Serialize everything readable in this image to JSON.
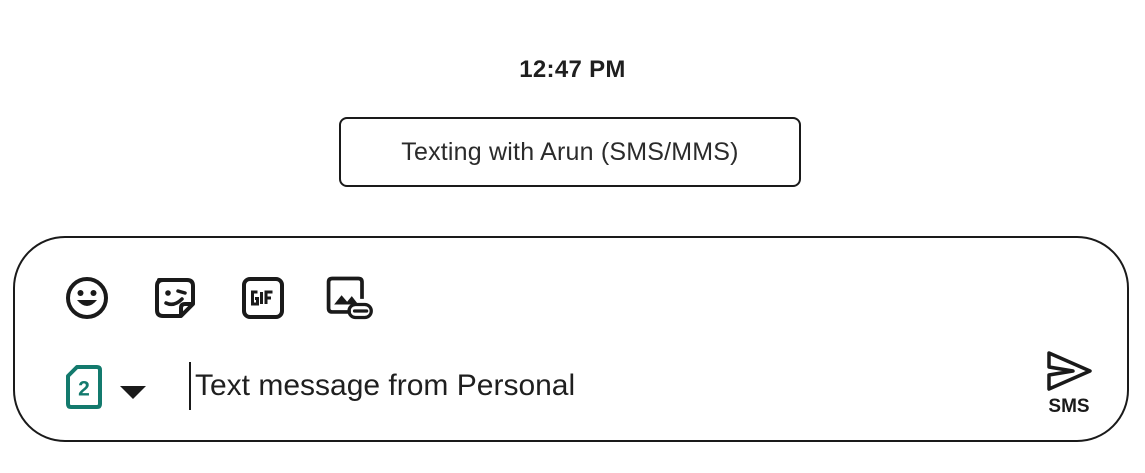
{
  "conversation": {
    "timestamp": "12:47 PM",
    "info_chip": "Texting with Arun (SMS/MMS)"
  },
  "composer": {
    "tools": [
      {
        "name": "emoji",
        "icon": "emoji-icon"
      },
      {
        "name": "sticker",
        "icon": "sticker-icon"
      },
      {
        "name": "gif",
        "icon": "gif-icon",
        "glyph_text": "GIF"
      },
      {
        "name": "attach-media",
        "icon": "image-attach-icon"
      }
    ],
    "sim": {
      "number": "2",
      "icon": "sim-card-icon",
      "dropdown_icon": "caret-down-icon",
      "color": "#137a6d"
    },
    "input": {
      "placeholder": "Text message from Personal",
      "value": ""
    },
    "send": {
      "icon": "send-icon",
      "label": "SMS"
    }
  }
}
